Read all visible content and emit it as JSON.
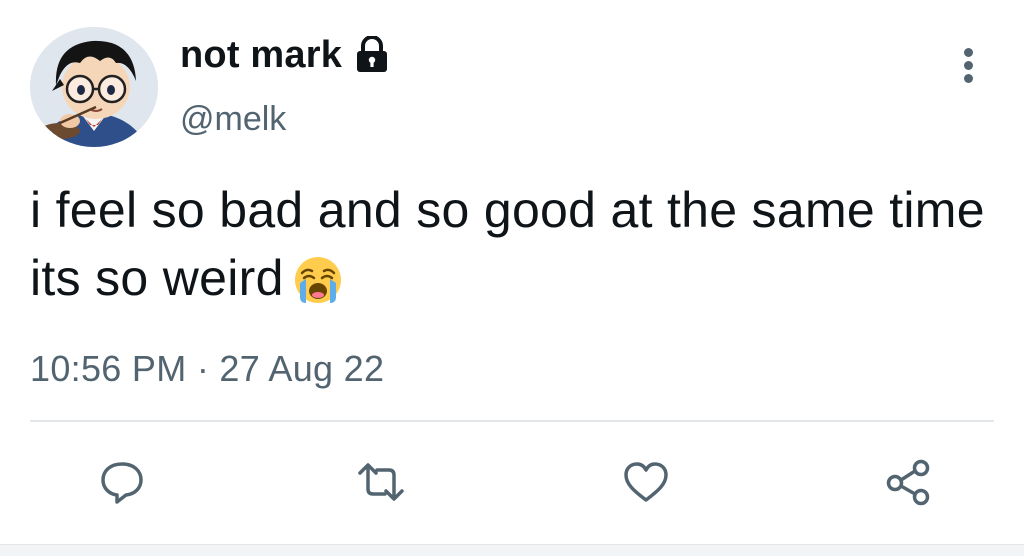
{
  "tweet": {
    "display_name": "not mark",
    "handle": "@melk",
    "text": "i feel so bad and so good at the same time its so weird",
    "emoji": "loudly-crying-face",
    "time": "10:56 PM",
    "separator": "·",
    "date": "27 Aug 22",
    "protected": true
  },
  "icons": {
    "lock": "lock-icon",
    "more": "more-vertical-icon",
    "reply": "reply-icon",
    "retweet": "retweet-icon",
    "like": "heart-icon",
    "share": "share-icon"
  },
  "colors": {
    "text": "#0f1419",
    "secondary": "#536471",
    "divider": "#e3e7ea"
  }
}
